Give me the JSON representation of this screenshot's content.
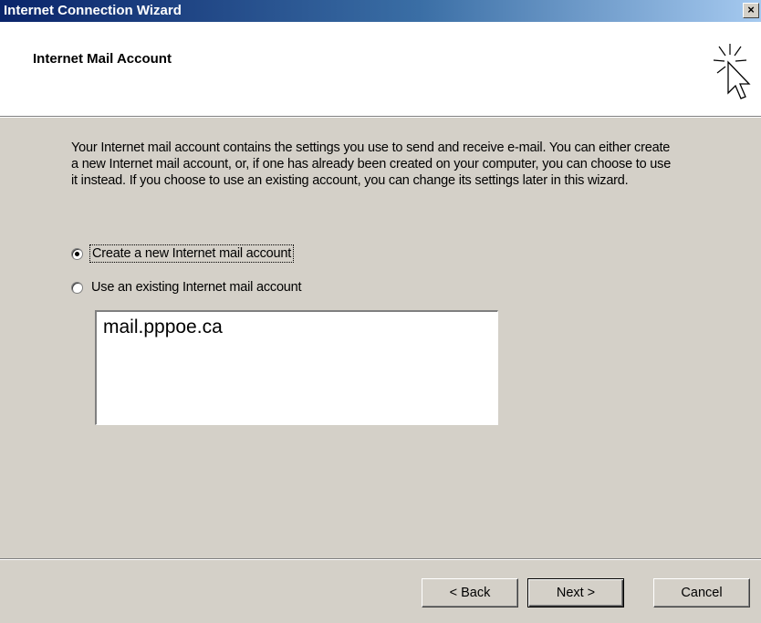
{
  "window": {
    "title": "Internet Connection Wizard",
    "close_glyph": "×"
  },
  "header": {
    "title": "Internet Mail Account",
    "icon": "wizard-cursor-icon"
  },
  "intro_text": "Your Internet mail account contains the settings you use to send and receive e-mail. You can either create a new Internet mail account, or, if one has already been created on your computer, you can choose to use it instead. If you choose to use an existing account, you can change its settings later in this wizard.",
  "options": [
    {
      "label": "Create a new Internet mail account",
      "selected": true
    },
    {
      "label": "Use an existing Internet mail account",
      "selected": false
    }
  ],
  "accounts_list": [
    "mail.pppoe.ca"
  ],
  "buttons": {
    "back": "< Back",
    "next": "Next >",
    "cancel": "Cancel"
  },
  "colors": {
    "titlebar_start": "#0a246a",
    "titlebar_end": "#a6caf0",
    "dialog_face": "#d4d0c8"
  }
}
